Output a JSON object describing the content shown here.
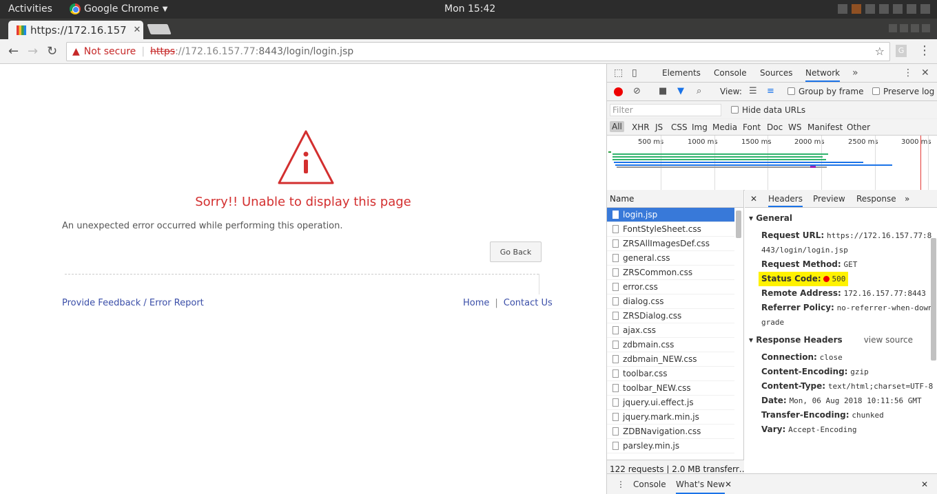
{
  "system": {
    "activities": "Activities",
    "app_menu": "Google Chrome",
    "clock": "Mon 15:42"
  },
  "browser": {
    "tab_title": "https://172.16.157.",
    "address": {
      "security_label": "Not secure",
      "protocol": "https",
      "host": "://172.16.157.77:",
      "port_path": "8443/login/login.jsp"
    },
    "extension_label": "G"
  },
  "page": {
    "error_title": "Sorry!! Unable to display this page",
    "error_message": "An unexpected error occurred while performing this operation.",
    "go_back": "Go Back",
    "feedback_link": "Provide Feedback / Error Report",
    "home_link": "Home",
    "link_separator": "|",
    "contact_link": "Contact Us"
  },
  "devtools": {
    "tabs": [
      "Elements",
      "Console",
      "Sources",
      "Network"
    ],
    "active_tab": "Network",
    "toolbar": {
      "view_label": "View:",
      "group_by_frame": "Group by frame",
      "preserve_log": "Preserve log"
    },
    "filter_placeholder": "Filter",
    "hide_data_urls": "Hide data URLs",
    "types": [
      "All",
      "XHR",
      "JS",
      "CSS",
      "Img",
      "Media",
      "Font",
      "Doc",
      "WS",
      "Manifest",
      "Other"
    ],
    "timeline_ticks": [
      "500 ms",
      "1000 ms",
      "1500 ms",
      "2000 ms",
      "2500 ms",
      "3000 ms"
    ],
    "name_header": "Name",
    "requests": [
      "login.jsp",
      "FontStyleSheet.css",
      "ZRSAllImagesDef.css",
      "general.css",
      "ZRSCommon.css",
      "error.css",
      "dialog.css",
      "ZRSDialog.css",
      "ajax.css",
      "zdbmain.css",
      "zdbmain_NEW.css",
      "toolbar.css",
      "toolbar_NEW.css",
      "jquery.ui.effect.js",
      "jquery.mark.min.js",
      "ZDBNavigation.css",
      "parsley.min.js"
    ],
    "summary": "122 requests  |  2.0 MB transferr…",
    "detail_tabs": [
      "Headers",
      "Preview",
      "Response"
    ],
    "general": {
      "title": "General",
      "request_url_label": "Request URL:",
      "request_url_value": "https://172.16.157.77:8443/login/login.jsp",
      "method_label": "Request Method:",
      "method_value": "GET",
      "status_label": "Status Code:",
      "status_value": "500",
      "remote_label": "Remote Address:",
      "remote_value": "172.16.157.77:8443",
      "referrer_label": "Referrer Policy:",
      "referrer_value": "no-referrer-when-downgrade"
    },
    "response_headers": {
      "title": "Response Headers",
      "view_source": "view source",
      "connection_label": "Connection:",
      "connection_value": "close",
      "encoding_label": "Content-Encoding:",
      "encoding_value": "gzip",
      "type_label": "Content-Type:",
      "type_value": "text/html;charset=UTF-8",
      "date_label": "Date:",
      "date_value": "Mon, 06 Aug 2018 10:11:56 GMT",
      "transfer_label": "Transfer-Encoding:",
      "transfer_value": "chunked",
      "vary_label": "Vary:",
      "vary_value": "Accept-Encoding"
    },
    "drawer": {
      "console": "Console",
      "whats_new": "What's New"
    }
  }
}
